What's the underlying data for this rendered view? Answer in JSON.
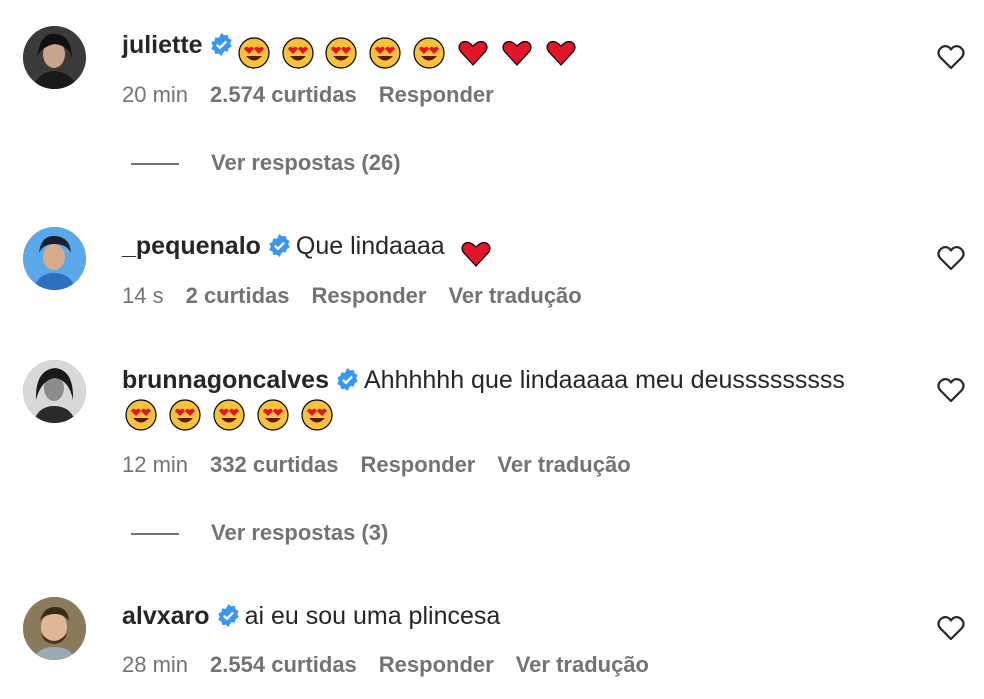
{
  "comments": [
    {
      "username": "juliette",
      "verified": true,
      "text": "",
      "emojis": [
        "heart-eyes",
        "heart-eyes",
        "heart-eyes",
        "heart-eyes",
        "heart-eyes",
        "red-heart",
        "red-heart",
        "red-heart"
      ],
      "time": "20 min",
      "likes": "2.574 curtidas",
      "reply_label": "Responder",
      "translate_label": "",
      "view_replies": "Ver respostas (26)"
    },
    {
      "username": "_pequenalo",
      "verified": true,
      "text": "Que lindaaaa",
      "emojis": [
        "red-heart"
      ],
      "time": "14 s",
      "likes": "2 curtidas",
      "reply_label": "Responder",
      "translate_label": "Ver tradução",
      "view_replies": ""
    },
    {
      "username": "brunnagoncalves",
      "verified": true,
      "text": "Ahhhhhh que lindaaaaa meu deusssssssss",
      "emojis": [
        "heart-eyes",
        "heart-eyes",
        "heart-eyes",
        "heart-eyes",
        "heart-eyes"
      ],
      "time": "12 min",
      "likes": "332 curtidas",
      "reply_label": "Responder",
      "translate_label": "Ver tradução",
      "view_replies": "Ver respostas (3)"
    },
    {
      "username": "alvxaro",
      "verified": true,
      "text": "ai eu sou uma plincesa",
      "emojis": [],
      "time": "28 min",
      "likes": "2.554 curtidas",
      "reply_label": "Responder",
      "translate_label": "Ver tradução",
      "view_replies": ""
    }
  ],
  "colors": {
    "verified_blue": "#3897f0",
    "meta_gray": "#737373",
    "heart_red": "#e0162b"
  },
  "icons": {
    "like": "heart-outline-icon",
    "verified": "verified-badge-icon"
  }
}
